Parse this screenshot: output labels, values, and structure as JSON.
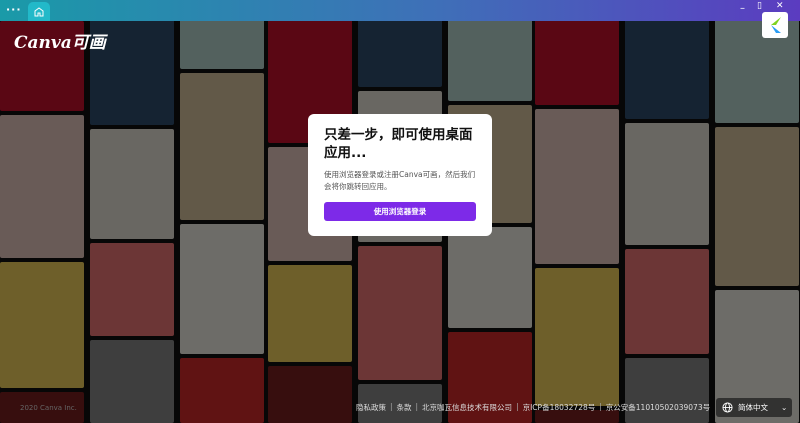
{
  "titlebar": {
    "menu_label": "···",
    "home_icon": "home-icon",
    "minimize": "–",
    "restore": "▯",
    "close": "✕"
  },
  "logo": "Canva可画",
  "modal": {
    "title": "只差一步，即可使用桌面应用...",
    "body": "使用浏览器登录或注册Canva可画，然后我们会将你跳转回应用。",
    "button": "使用浏览器登录"
  },
  "footer": {
    "links": [
      "隐私政策",
      "条款",
      "北京咖瓦信息技术有限公司",
      "京ICP备18032728号",
      "京公安备11010502039073号"
    ]
  },
  "copyright": "2020 Canva Inc.",
  "language": {
    "label": "简体中文",
    "icon": "globe-icon"
  },
  "colors": {
    "accent": "#7d2ae8"
  }
}
